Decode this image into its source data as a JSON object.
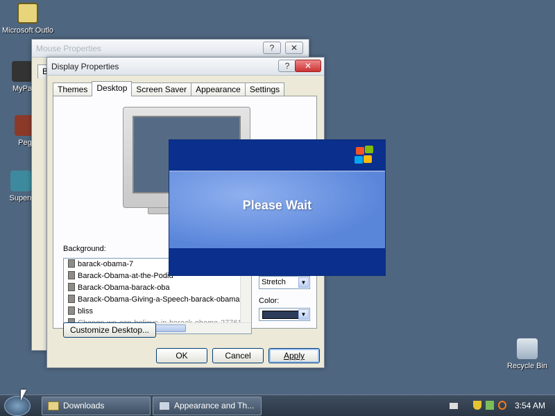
{
  "desktop": {
    "icons": {
      "outlook": "Microsoft Outlo",
      "mypa": "MyPa",
      "peg": "Peg",
      "super": "Superr",
      "recycle": "Recycle Bin"
    }
  },
  "mouse_window": {
    "title": "Mouse Properties",
    "tab_fragment": "B",
    "help": "?",
    "close": "✕"
  },
  "display_window": {
    "title": "Display Properties",
    "help": "?",
    "close": "✕",
    "tabs": [
      "Themes",
      "Desktop",
      "Screen Saver",
      "Appearance",
      "Settings"
    ],
    "active_tab": "Desktop",
    "background_label": "Background:",
    "backgrounds": [
      "barack-obama-7",
      "Barack-Obama-at-the-Podiu",
      "Barack-Obama-barack-oba",
      "Barack-Obama-Giving-a-Speech-barack-obama-7",
      "bliss",
      "Change-we-can-believe-in-barack-obama-27761"
    ],
    "hscroll_grip": "|||",
    "position_value": "Stretch",
    "color_label": "Color:",
    "color_value": "#2c3c5a",
    "customize_button": "Customize Desktop...",
    "ok_button": "OK",
    "cancel_button": "Cancel",
    "apply_button": "Apply"
  },
  "splash": {
    "message": "Please Wait"
  },
  "taskbar": {
    "items": [
      "Downloads",
      "Appearance and Th..."
    ],
    "clock": "3:54 AM"
  },
  "colors": {
    "desktop": "#4f6680",
    "splash_blue": "#0b2f8d",
    "taskbar": "#2a3644"
  }
}
